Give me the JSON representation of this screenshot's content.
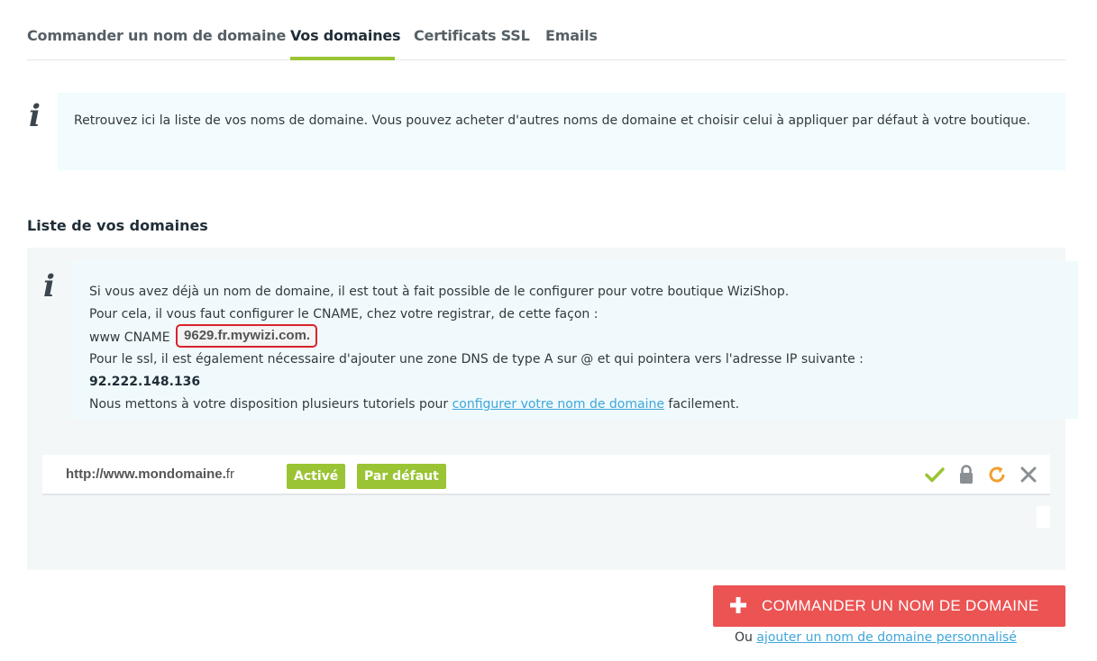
{
  "tabs": [
    {
      "label": "Commander un nom de domaine"
    },
    {
      "label": "Vos domaines"
    },
    {
      "label": "Certificats SSL"
    },
    {
      "label": "Emails"
    }
  ],
  "active_tab": "Vos domaines",
  "info_intro": {
    "icon": "info-icon",
    "text": "Retrouvez ici la liste de vos noms de domaine. Vous pouvez acheter d'autres noms de domaine et choisir celui à appliquer par défaut à votre boutique."
  },
  "domains_section": {
    "title": "Liste de vos domaines",
    "info": {
      "icon": "info-icon",
      "line1": "Si vous avez déjà un nom de domaine, il est tout à fait possible de le configurer pour votre boutique WiziShop.",
      "line2": "Pour cela, il vous faut configurer le CNAME, chez votre registrar, de cette façon :",
      "cname_label": "www CNAME",
      "cname_value": "9629.fr.mywizi.com.",
      "line4": "Pour le ssl, il est également nécessaire d'ajouter une zone DNS de type A sur @ et qui pointera vers l'adresse IP suivante :",
      "ip": "92.222.148.136",
      "line6_before": "Nous mettons à votre disposition plusieurs tutoriels pour",
      "line6_link": "configurer votre nom de domaine",
      "line6_after": "facilement."
    },
    "domain_row": {
      "url_main": "http://www.mondomaine.",
      "url_tld": "fr",
      "badge_active": "Activé",
      "badge_default": "Par défaut",
      "actions": [
        "check-icon",
        "lock-icon",
        "refresh-icon",
        "close-icon"
      ]
    }
  },
  "order_button": {
    "icon": "plus-icon",
    "label": "COMMANDER UN NOM DE DOMAINE"
  },
  "custom_domain": {
    "prefix": "Ou",
    "link": "ajouter un nom de domaine personnalisé"
  },
  "colors": {
    "accent_green": "#9ac434",
    "order_red": "#ec5353",
    "link_blue": "#3fa6d9",
    "cname_highlight": "#d9222b",
    "refresh_orange": "#f0a030"
  }
}
